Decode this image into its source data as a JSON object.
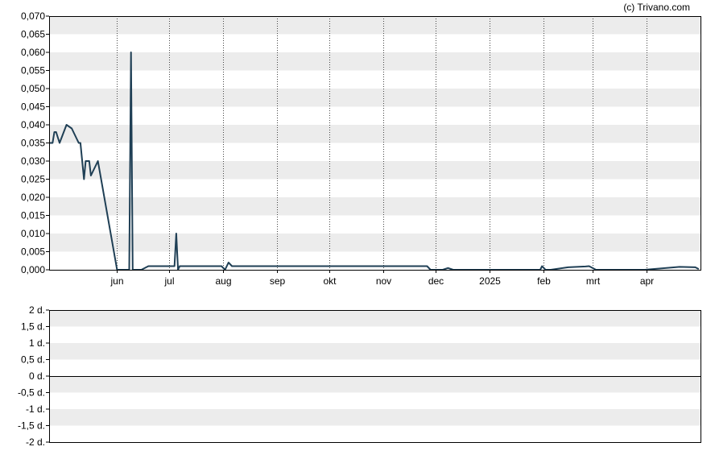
{
  "chart_data": [
    {
      "type": "line",
      "watermark": "(c) Trivano.com",
      "ylim": [
        0,
        0.07
      ],
      "y_ticks": [
        "0,000",
        "0,005",
        "0,010",
        "0,015",
        "0,020",
        "0,025",
        "0,030",
        "0,035",
        "0,040",
        "0,045",
        "0,050",
        "0,055",
        "0,060",
        "0,065",
        "0,070"
      ],
      "x_ticks": [
        {
          "label": "jun",
          "date": "2024-06-01"
        },
        {
          "label": "jul",
          "date": "2024-07-01"
        },
        {
          "label": "aug",
          "date": "2024-08-01"
        },
        {
          "label": "sep",
          "date": "2024-09-01"
        },
        {
          "label": "okt",
          "date": "2024-10-01"
        },
        {
          "label": "nov",
          "date": "2024-11-01"
        },
        {
          "label": "dec",
          "date": "2024-12-01"
        },
        {
          "label": "2025",
          "date": "2025-01-01"
        },
        {
          "label": "feb",
          "date": "2025-02-01"
        },
        {
          "label": "mrt",
          "date": "2025-03-01"
        },
        {
          "label": "apr",
          "date": "2025-04-01"
        }
      ],
      "xlim": [
        "2024-04-23",
        "2025-05-02"
      ],
      "colors": {
        "line": "#1f3f55",
        "band": "#ececec",
        "grid": "#444444"
      },
      "series": [
        {
          "x": [
            "2024-04-23",
            "2024-04-25",
            "2024-04-26",
            "2024-04-27",
            "2024-04-29",
            "2024-05-03",
            "2024-05-06",
            "2024-05-09",
            "2024-05-10",
            "2024-05-11",
            "2024-05-12",
            "2024-05-13",
            "2024-05-14",
            "2024-05-16",
            "2024-05-17",
            "2024-05-21",
            "2024-06-01",
            "2024-06-04",
            "2024-06-07",
            "2024-06-08",
            "2024-06-09",
            "2024-06-10",
            "2024-06-15",
            "2024-06-19",
            "2024-06-29",
            "2024-07-04",
            "2024-07-05",
            "2024-07-06",
            "2024-07-07",
            "2024-07-31",
            "2024-08-02",
            "2024-08-04",
            "2024-08-06",
            "2024-11-26",
            "2024-11-28",
            "2024-12-05",
            "2024-12-08",
            "2024-12-11",
            "2025-01-30",
            "2025-01-31",
            "2025-02-02",
            "2025-02-05",
            "2025-02-15",
            "2025-02-25",
            "2025-02-27",
            "2025-03-03",
            "2025-03-31",
            "2025-04-20",
            "2025-04-29",
            "2025-05-01"
          ],
          "y": [
            0.035,
            0.035,
            0.038,
            0.038,
            0.035,
            0.04,
            0.039,
            0.036,
            0.035,
            0.035,
            0.03,
            0.025,
            0.03,
            0.03,
            0.026,
            0.03,
            0,
            0,
            0,
            0,
            0.06,
            0,
            0,
            0.001,
            0.001,
            0.001,
            0.01,
            0,
            0.001,
            0.001,
            0,
            0.002,
            0.001,
            0.001,
            0,
            0,
            0.0005,
            0,
            0,
            0.001,
            0,
            0,
            0.0007,
            0.0009,
            0.001,
            0,
            0,
            0.0008,
            0.0007,
            0.0002
          ]
        }
      ]
    },
    {
      "type": "line",
      "ylim": [
        -2,
        2
      ],
      "y_ticks": [
        "-2 d.",
        "-1,5 d.",
        "-1 d.",
        "-0,5 d.",
        "0 d.",
        "0,5 d.",
        "1 d.",
        "1,5 d.",
        "2 d."
      ],
      "series": []
    }
  ]
}
